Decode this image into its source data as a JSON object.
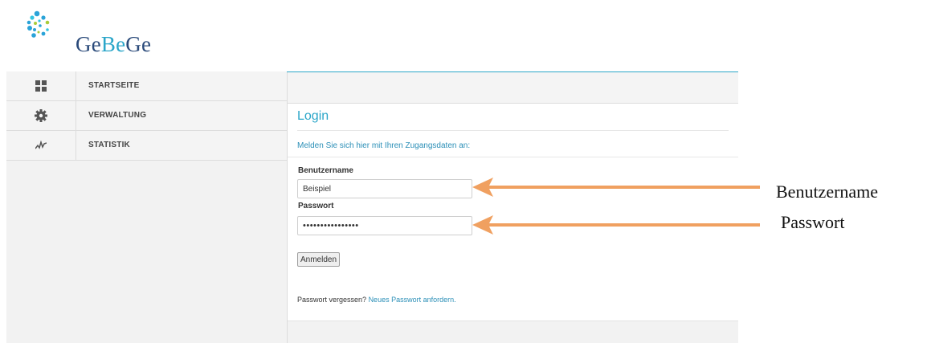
{
  "brand": {
    "prefix": "Ge",
    "accent": "Be",
    "suffix": "Ge"
  },
  "sidebar": {
    "items": [
      {
        "label": "STARTSEITE",
        "icon": "dashboard-grid-icon"
      },
      {
        "label": "VERWALTUNG",
        "icon": "gear-icon"
      },
      {
        "label": "STATISTIK",
        "icon": "activity-chart-icon"
      }
    ]
  },
  "login": {
    "title": "Login",
    "intro": "Melden Sie sich hier mit Ihren Zugangsdaten an:",
    "username_label": "Benutzername",
    "username_value": "Beispiel",
    "password_label": "Passwort",
    "password_value": "••••••••••••••••",
    "submit_label": "Anmelden",
    "forgot_text": "Passwort vergessen?",
    "forgot_link": "Neues Passwort anfordern."
  },
  "annotations": {
    "username_callout": "Benutzername",
    "password_callout": "Passwort"
  },
  "colors": {
    "accent": "#2ba6c9",
    "arrow": "#f0a060",
    "brand_dark": "#2a4a7a"
  }
}
